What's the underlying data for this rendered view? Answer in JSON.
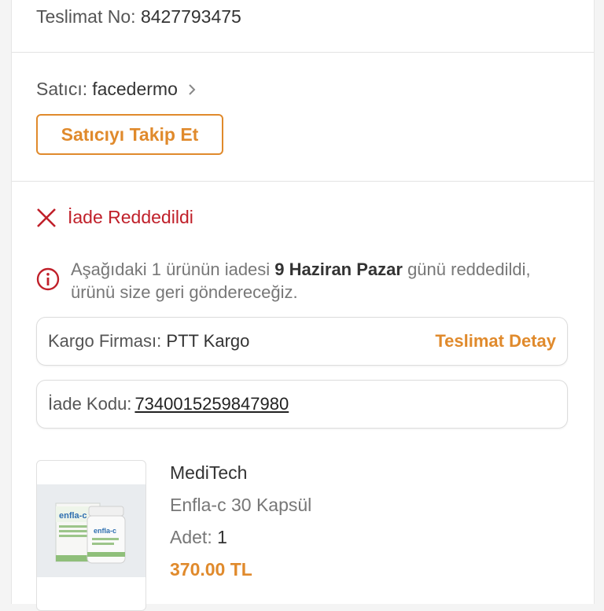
{
  "delivery": {
    "label": "Teslimat No:",
    "number": "8427793475"
  },
  "seller": {
    "label": "Satıcı:",
    "name": "facedermo",
    "follow_button": "Satıcıyı Takip Et"
  },
  "status": {
    "label": "İade Reddedildi",
    "icon": "close-icon",
    "color": "#c0202a"
  },
  "info": {
    "text_before": "Aşağıdaki 1 ürünün iadesi",
    "date": "9 Haziran Pazar",
    "text_after": "günü reddedildi, ürünü size geri göndereceğiz.",
    "icon": "info-icon"
  },
  "cargo": {
    "label": "Kargo Firması:",
    "company": "PTT Kargo",
    "detail_link": "Teslimat Detay"
  },
  "return_code": {
    "label": "İade Kodu:",
    "code": "7340015259847980"
  },
  "product": {
    "brand": "MediTech",
    "name": "Enfla-c 30 Kapsül",
    "quantity_label": "Adet:",
    "quantity": "1",
    "price": "370.00 TL",
    "image_label": "enfla-c"
  },
  "colors": {
    "accent": "#e08a2c",
    "error": "#c0202a",
    "border": "#dcdcdc"
  }
}
